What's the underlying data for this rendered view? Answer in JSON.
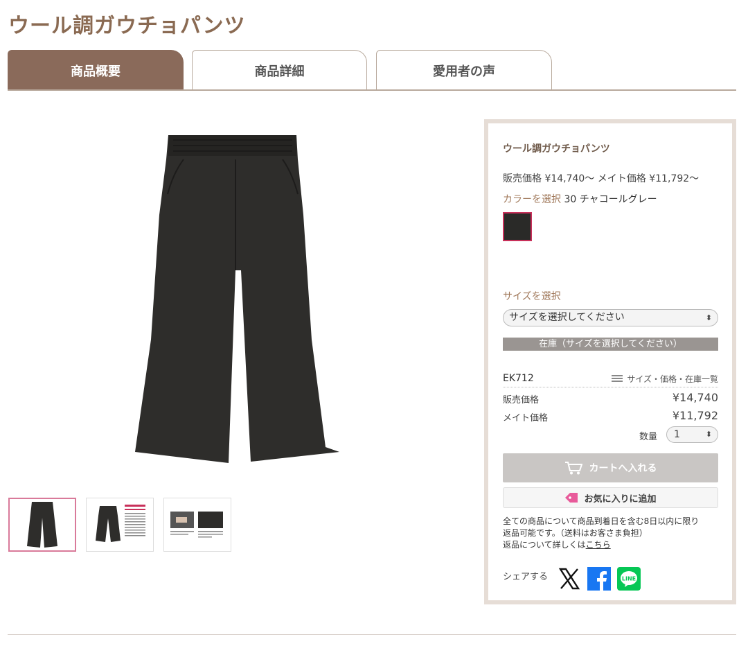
{
  "page": {
    "title": "ウール調ガウチョパンツ"
  },
  "tabs": [
    {
      "label": "商品概要",
      "active": true
    },
    {
      "label": "商品詳細",
      "active": false
    },
    {
      "label": "愛用者の声",
      "active": false
    }
  ],
  "product": {
    "name": "ウール調ガウチョパンツ",
    "price_line": "販売価格 ¥14,740〜 メイト価格 ¥11,792〜",
    "color_label": "カラーを選択",
    "color_value": "30 チャコールグレー",
    "swatch_color": "#2a2a28",
    "size_label": "サイズを選択",
    "size_select_value": "サイズを選択してください",
    "stock_text": "在庫（サイズを選択してください）",
    "code": "EK712",
    "size_list_link": "サイズ・価格・在庫一覧",
    "sale_price_label": "販売価格",
    "sale_price": "¥14,740",
    "mate_price_label": "メイト価格",
    "mate_price": "¥11,792",
    "qty_label": "数量",
    "qty_value": "1",
    "cart_button": "カートへ入れる",
    "fav_button": "お気に入りに追加",
    "return_text_1": "全ての商品について商品到着日を含む8日以内に限り",
    "return_text_2": "返品可能です。（送料はお客さま負担）",
    "return_text_3": "返品について詳しくは",
    "return_link": "こちら",
    "share_label": "シェアする"
  },
  "thumbnails": [
    {
      "name": "thumb-front",
      "active": true
    },
    {
      "name": "thumb-detail-text",
      "active": false
    },
    {
      "name": "thumb-closeup",
      "active": false
    }
  ],
  "colors": {
    "brand_brown": "#8a6a5a",
    "title_brown": "#8a6a52",
    "swatch_border": "#c8305a",
    "facebook": "#1877f2",
    "line": "#06c755"
  },
  "icons": [
    "cart-icon",
    "tag-icon",
    "list-icon",
    "x-icon",
    "facebook-icon",
    "line-icon",
    "chevron-updown-icon"
  ]
}
